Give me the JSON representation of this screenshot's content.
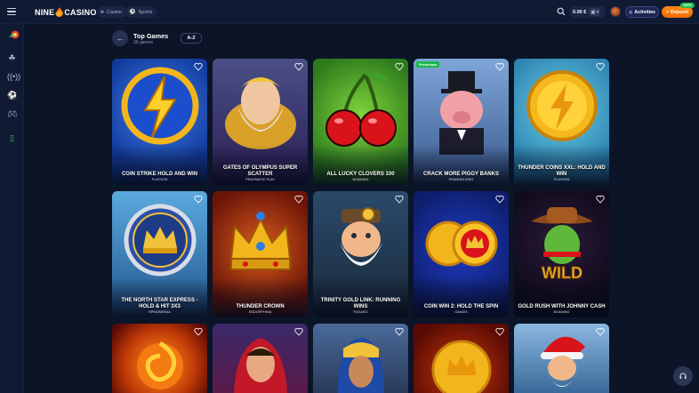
{
  "header": {
    "logo_left": "NINE",
    "logo_right": "CASINO",
    "nav": [
      {
        "label": "Casino",
        "icon": "casino-icon"
      },
      {
        "label": "Sports",
        "icon": "sports-icon"
      }
    ],
    "balance": "0.00 €",
    "activities_label": "Activities",
    "deposit_label": "Deposit",
    "deposit_badge": "100%"
  },
  "page": {
    "title": "Top Games",
    "subtitle": "39 games",
    "sort_label": "A-Z"
  },
  "games": [
    {
      "name": "COIN STRIKE HOLD AND WIN",
      "provider": "PLAYSON",
      "badge": ""
    },
    {
      "name": "GATES OF OLYMPUS SUPER SCATTER",
      "provider": "PRAGMATIC PLAY",
      "badge": ""
    },
    {
      "name": "ALL LUCKY CLOVERS 100",
      "provider": "BGAMING",
      "badge": ""
    },
    {
      "name": "CRACK MORE PIGGY BANKS",
      "provider": "PENGUIN KING",
      "badge": "Prerelease"
    },
    {
      "name": "THUNDER COINS XXL: HOLD AND WIN",
      "provider": "PLAYSON",
      "badge": ""
    },
    {
      "name": "THE NORTH STAR EXPRESS - HOLD & HIT 3X3",
      "provider": "SPINOMENAL",
      "badge": ""
    },
    {
      "name": "THUNDER CROWN",
      "provider": "ENDORPHINA",
      "badge": ""
    },
    {
      "name": "TRINITY GOLD LINK: RUNNING WINS",
      "provider": "FUGASO",
      "badge": ""
    },
    {
      "name": "COIN WIN 2: HOLD THE SPIN",
      "provider": "GAMZIX",
      "badge": ""
    },
    {
      "name": "GOLD RUSH WITH JOHNNY CASH",
      "provider": "BGAMING",
      "badge": ""
    }
  ],
  "colors": {
    "accent": "#f46a00",
    "background": "#0c1428",
    "panel": "#101a33",
    "prerelease": "#19b84a"
  }
}
